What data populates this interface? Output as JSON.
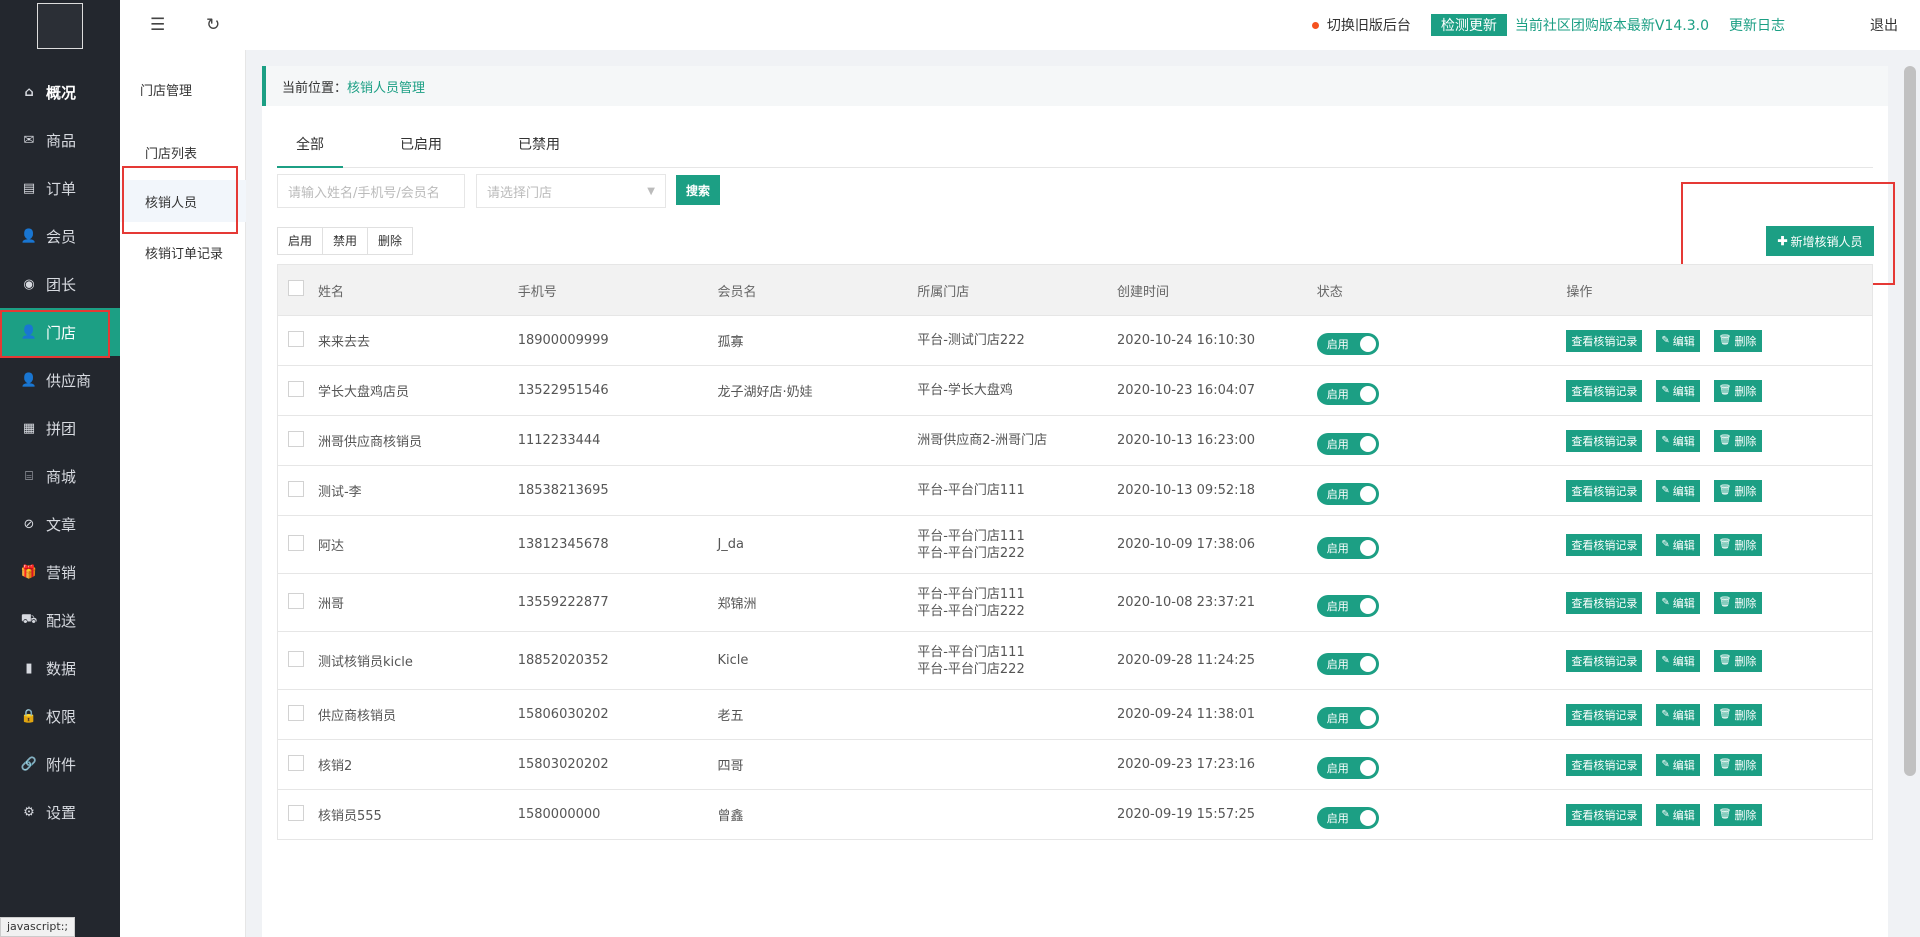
{
  "sidebar": {
    "items": [
      {
        "label": "概况",
        "icon": "home-icon",
        "glyph": "⌂"
      },
      {
        "label": "商品",
        "icon": "mail-icon",
        "glyph": "✉"
      },
      {
        "label": "订单",
        "icon": "file-icon",
        "glyph": "▤"
      },
      {
        "label": "会员",
        "icon": "user-icon",
        "glyph": "👤"
      },
      {
        "label": "团长",
        "icon": "badge-icon",
        "glyph": "◉"
      },
      {
        "label": "门店",
        "icon": "store-user-icon",
        "glyph": "👤"
      },
      {
        "label": "供应商",
        "icon": "supplier-icon",
        "glyph": "👤"
      },
      {
        "label": "拼团",
        "icon": "grid-icon",
        "glyph": "▦"
      },
      {
        "label": "商城",
        "icon": "shop-icon",
        "glyph": "⌸"
      },
      {
        "label": "文章",
        "icon": "compass-icon",
        "glyph": "⊘"
      },
      {
        "label": "营销",
        "icon": "gift-icon",
        "glyph": "🎁"
      },
      {
        "label": "配送",
        "icon": "truck-icon",
        "glyph": "⛟"
      },
      {
        "label": "数据",
        "icon": "chart-icon",
        "glyph": "▮"
      },
      {
        "label": "权限",
        "icon": "lock-icon",
        "glyph": "🔒"
      },
      {
        "label": "附件",
        "icon": "link-icon",
        "glyph": "🔗"
      },
      {
        "label": "设置",
        "icon": "gear-icon",
        "glyph": "⚙"
      }
    ]
  },
  "subnav": {
    "title": "门店管理",
    "items": [
      "门店列表",
      "核销人员",
      "核销订单记录"
    ]
  },
  "topbar": {
    "switch_label": "切换旧版后台",
    "check_update": "检测更新",
    "version_text": "当前社区团购版本最新V14.3.0",
    "log_label": "更新日志",
    "exit_label": "退出"
  },
  "breadcrumb": {
    "prefix": "当前位置：",
    "current": "核销人员管理"
  },
  "tabs": [
    "全部",
    "已启用",
    "已禁用"
  ],
  "filters": {
    "keyword_placeholder": "请输入姓名/手机号/会员名",
    "store_placeholder": "请选择门店",
    "search_label": "搜索"
  },
  "add_button": "新增核销人员",
  "batch": [
    "启用",
    "禁用",
    "删除"
  ],
  "table": {
    "headers": [
      "姓名",
      "手机号",
      "会员名",
      "所属门店",
      "创建时间",
      "状态",
      "操作"
    ],
    "ops": {
      "view": "查看核销记录",
      "edit": "编辑",
      "delete": "删除"
    },
    "status_on": "启用",
    "rows": [
      {
        "name": "来来去去",
        "phone": "18900009999",
        "member": "孤寡",
        "store": [
          "平台-测试门店222"
        ],
        "time": "2020-10-24 16:10:30"
      },
      {
        "name": "学长大盘鸡店员",
        "phone": "13522951546",
        "member": "龙子湖好店·奶娃",
        "store": [
          "平台-学长大盘鸡"
        ],
        "time": "2020-10-23 16:04:07"
      },
      {
        "name": "洲哥供应商核销员",
        "phone": "1112233444",
        "member": "",
        "store": [
          "洲哥供应商2-洲哥门店"
        ],
        "time": "2020-10-13 16:23:00"
      },
      {
        "name": "测试-李",
        "phone": "18538213695",
        "member": "",
        "store": [
          "平台-平台门店111"
        ],
        "time": "2020-10-13 09:52:18"
      },
      {
        "name": "阿达",
        "phone": "13812345678",
        "member": "J_da",
        "store": [
          "平台-平台门店111",
          "平台-平台门店222"
        ],
        "time": "2020-10-09 17:38:06"
      },
      {
        "name": "洲哥",
        "phone": "13559222877",
        "member": "郑锦洲",
        "store": [
          "平台-平台门店111",
          "平台-平台门店222"
        ],
        "time": "2020-10-08 23:37:21"
      },
      {
        "name": "测试核销员kicle",
        "phone": "18852020352",
        "member": "Kicle",
        "store": [
          "平台-平台门店111",
          "平台-平台门店222"
        ],
        "time": "2020-09-28 11:24:25"
      },
      {
        "name": "供应商核销员",
        "phone": "15806030202",
        "member": "老五",
        "store": [],
        "time": "2020-09-24 11:38:01"
      },
      {
        "name": "核销2",
        "phone": "15803020202",
        "member": "四哥",
        "store": [],
        "time": "2020-09-23 17:23:16"
      },
      {
        "name": "核销员555",
        "phone": "1580000000",
        "member": "曾鑫",
        "store": [],
        "time": "2020-09-19 15:57:25"
      }
    ]
  },
  "statusbar": "javascript:;"
}
